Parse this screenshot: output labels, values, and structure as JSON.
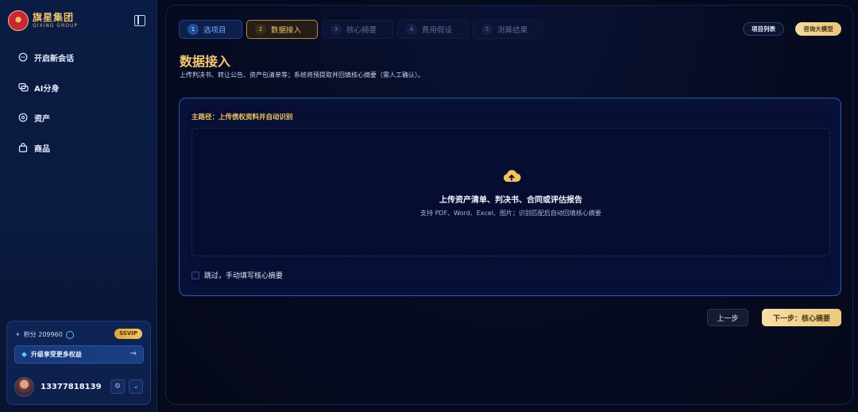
{
  "brand": {
    "name_cn": "旗星集团",
    "name_en": "QIXING GROUP"
  },
  "sidebar": {
    "items": [
      {
        "label": "开启新会话",
        "icon": "chat-icon"
      },
      {
        "label": "AI分身",
        "icon": "layers-icon"
      },
      {
        "label": "资产",
        "icon": "asset-icon"
      },
      {
        "label": "商品",
        "icon": "bag-icon"
      }
    ]
  },
  "member": {
    "points_label": "积分 209960",
    "vip_badge": "SSVIP",
    "upgrade_label": "升级享受更多权益",
    "phone": "13377818139"
  },
  "steps": [
    {
      "num": "1",
      "label": "选项目",
      "state": "done"
    },
    {
      "num": "2",
      "label": "数据接入",
      "state": "active"
    },
    {
      "num": "3",
      "label": "核心摘要",
      "state": "pending"
    },
    {
      "num": "4",
      "label": "费用假设",
      "state": "pending"
    },
    {
      "num": "5",
      "label": "测算结果",
      "state": "pending"
    }
  ],
  "header": {
    "projects_btn": "项目列表",
    "consult_btn": "咨询大模型"
  },
  "page": {
    "title": "数据接入",
    "description": "上传判决书、转让公告、资产包清单等；系统将预提取并回填核心摘要（需人工确认）。"
  },
  "upload": {
    "main_path_label": "主路径：上传债权资料并自动识别",
    "title": "上传资产清单、判决书、合同或评估报告",
    "subtitle": "支持 PDF、Word、Excel、图片；识别匹配后自动回填核心摘要",
    "skip_label": "跳过，手动填写核心摘要",
    "skip_checked": false
  },
  "footer": {
    "prev_label": "上一步",
    "next_label": "下一步：核心摘要"
  },
  "colors": {
    "accent_gold": "#f0c463",
    "accent_blue": "#6fb0ff",
    "panel_border": "#2a5aa8"
  }
}
